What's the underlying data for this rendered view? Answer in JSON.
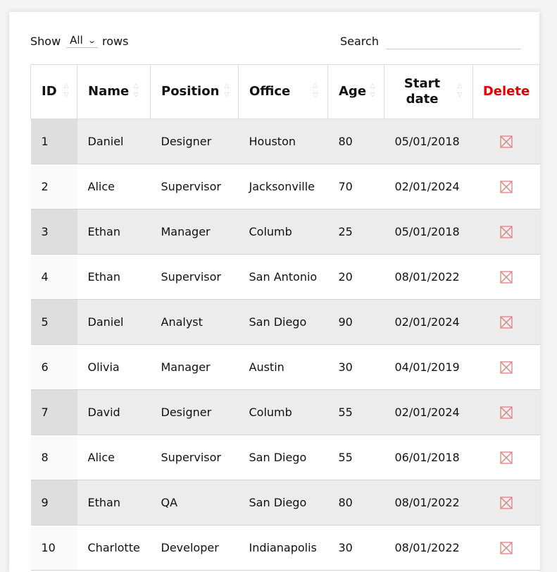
{
  "controls": {
    "show_label": "Show",
    "rows_label": "rows",
    "length_value": "All",
    "search_label": "Search",
    "search_value": ""
  },
  "table": {
    "headers": {
      "id": "ID",
      "name": "Name",
      "position": "Position",
      "office": "Office",
      "age": "Age",
      "start_line1": "Start",
      "start_line2": "date",
      "delete": "Delete"
    },
    "rows": [
      {
        "id": "1",
        "name": "Daniel",
        "position": "Designer",
        "office": "Houston",
        "age": "80",
        "start": "05/01/2018"
      },
      {
        "id": "2",
        "name": "Alice",
        "position": "Supervisor",
        "office": "Jacksonville",
        "age": "70",
        "start": "02/01/2024"
      },
      {
        "id": "3",
        "name": "Ethan",
        "position": "Manager",
        "office": "Columb",
        "age": "25",
        "start": "05/01/2018"
      },
      {
        "id": "4",
        "name": "Ethan",
        "position": "Supervisor",
        "office": "San Antonio",
        "age": "20",
        "start": "08/01/2022"
      },
      {
        "id": "5",
        "name": "Daniel",
        "position": "Analyst",
        "office": "San Diego",
        "age": "90",
        "start": "02/01/2024"
      },
      {
        "id": "6",
        "name": "Olivia",
        "position": "Manager",
        "office": "Austin",
        "age": "30",
        "start": "04/01/2019"
      },
      {
        "id": "7",
        "name": "David",
        "position": "Designer",
        "office": "Columb",
        "age": "55",
        "start": "02/01/2024"
      },
      {
        "id": "8",
        "name": "Alice",
        "position": "Supervisor",
        "office": "San Diego",
        "age": "55",
        "start": "06/01/2018"
      },
      {
        "id": "9",
        "name": "Ethan",
        "position": "QA",
        "office": "San Diego",
        "age": "80",
        "start": "08/01/2022"
      },
      {
        "id": "10",
        "name": "Charlotte",
        "position": "Developer",
        "office": "Indianapolis",
        "age": "30",
        "start": "08/01/2022"
      }
    ]
  },
  "colors": {
    "delete_header": "#e00000",
    "delete_icon": "#e08080",
    "row_stripe": "#ececec",
    "sort_arrows": "#d4d4d4"
  },
  "icons": {
    "sort": "sort-arrows-icon",
    "delete": "delete-x-box-icon",
    "dropdown": "chevron-down-icon"
  }
}
